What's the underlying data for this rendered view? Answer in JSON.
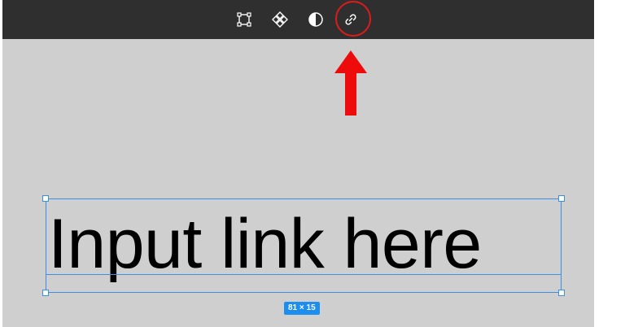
{
  "toolbar": {
    "background_color": "#2f2f2f",
    "tools": [
      {
        "name": "frame-tool",
        "icon": "frame-icon"
      },
      {
        "name": "component-tool",
        "icon": "component-icon"
      },
      {
        "name": "mask-tool",
        "icon": "half-circle-icon"
      },
      {
        "name": "link-tool",
        "icon": "link-icon",
        "highlighted": true
      }
    ]
  },
  "canvas": {
    "background_color": "#cfcfcf"
  },
  "text_layer": {
    "content": "Input link here",
    "selection_color": "#3d8ee6"
  },
  "size_badge": {
    "label": "81 × 15",
    "color": "#1c8ef0"
  },
  "annotation": {
    "color": "#e01b1b",
    "circle_target": "link-tool",
    "arrow_direction": "up"
  }
}
